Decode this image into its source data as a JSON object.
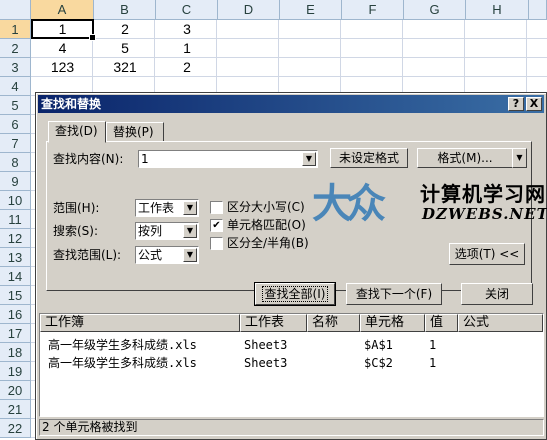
{
  "sheet": {
    "columns": [
      "A",
      "B",
      "C",
      "D",
      "E",
      "F",
      "G",
      "H"
    ],
    "rows": [
      "1",
      "2",
      "3",
      "4",
      "5",
      "6",
      "7",
      "8",
      "9",
      "10",
      "11",
      "12",
      "13",
      "14",
      "15",
      "16",
      "17",
      "18",
      "19",
      "20",
      "21",
      "22"
    ],
    "cells": [
      [
        "1",
        "2",
        "3"
      ],
      [
        "4",
        "5",
        "1"
      ],
      [
        "123",
        "321",
        "2"
      ]
    ]
  },
  "dialog": {
    "title": "查找和替换",
    "help_button": "?",
    "close_button": "X",
    "tabs": [
      "查找(D)",
      "替换(P)"
    ],
    "find_what_label": "查找内容(N):",
    "find_what_value": "1",
    "format_status": "未设定格式",
    "format_button": "格式(M)...",
    "within_label": "范围(H):",
    "within_value": "工作表",
    "search_label": "搜索(S):",
    "search_value": "按列",
    "look_in_label": "查找范围(L):",
    "look_in_value": "公式",
    "match_case_label": "区分大小写(C)",
    "match_case_checked": false,
    "match_entire_label": "单元格匹配(O)",
    "match_entire_checked": true,
    "match_byte_label": "区分全/半角(B)",
    "match_byte_checked": false,
    "options_button": "选项(T) <<",
    "find_all_button": "查找全部(I)",
    "find_next_button": "查找下一个(F)",
    "close_dialog_button": "关闭",
    "results": {
      "headers": [
        "工作簿",
        "工作表",
        "名称",
        "单元格",
        "值",
        "公式"
      ],
      "rows": [
        [
          "高一年级学生多科成绩.xls",
          "Sheet3",
          "",
          "$A$1",
          "1",
          ""
        ],
        [
          "高一年级学生多科成绩.xls",
          "Sheet3",
          "",
          "$C$2",
          "1",
          ""
        ]
      ]
    },
    "status": "2 个单元格被找到"
  },
  "watermark": {
    "logo": "大众",
    "name_cn": "计算机学习网",
    "name_en": "DZWEBS.NET",
    "color": "#4a86b8"
  }
}
